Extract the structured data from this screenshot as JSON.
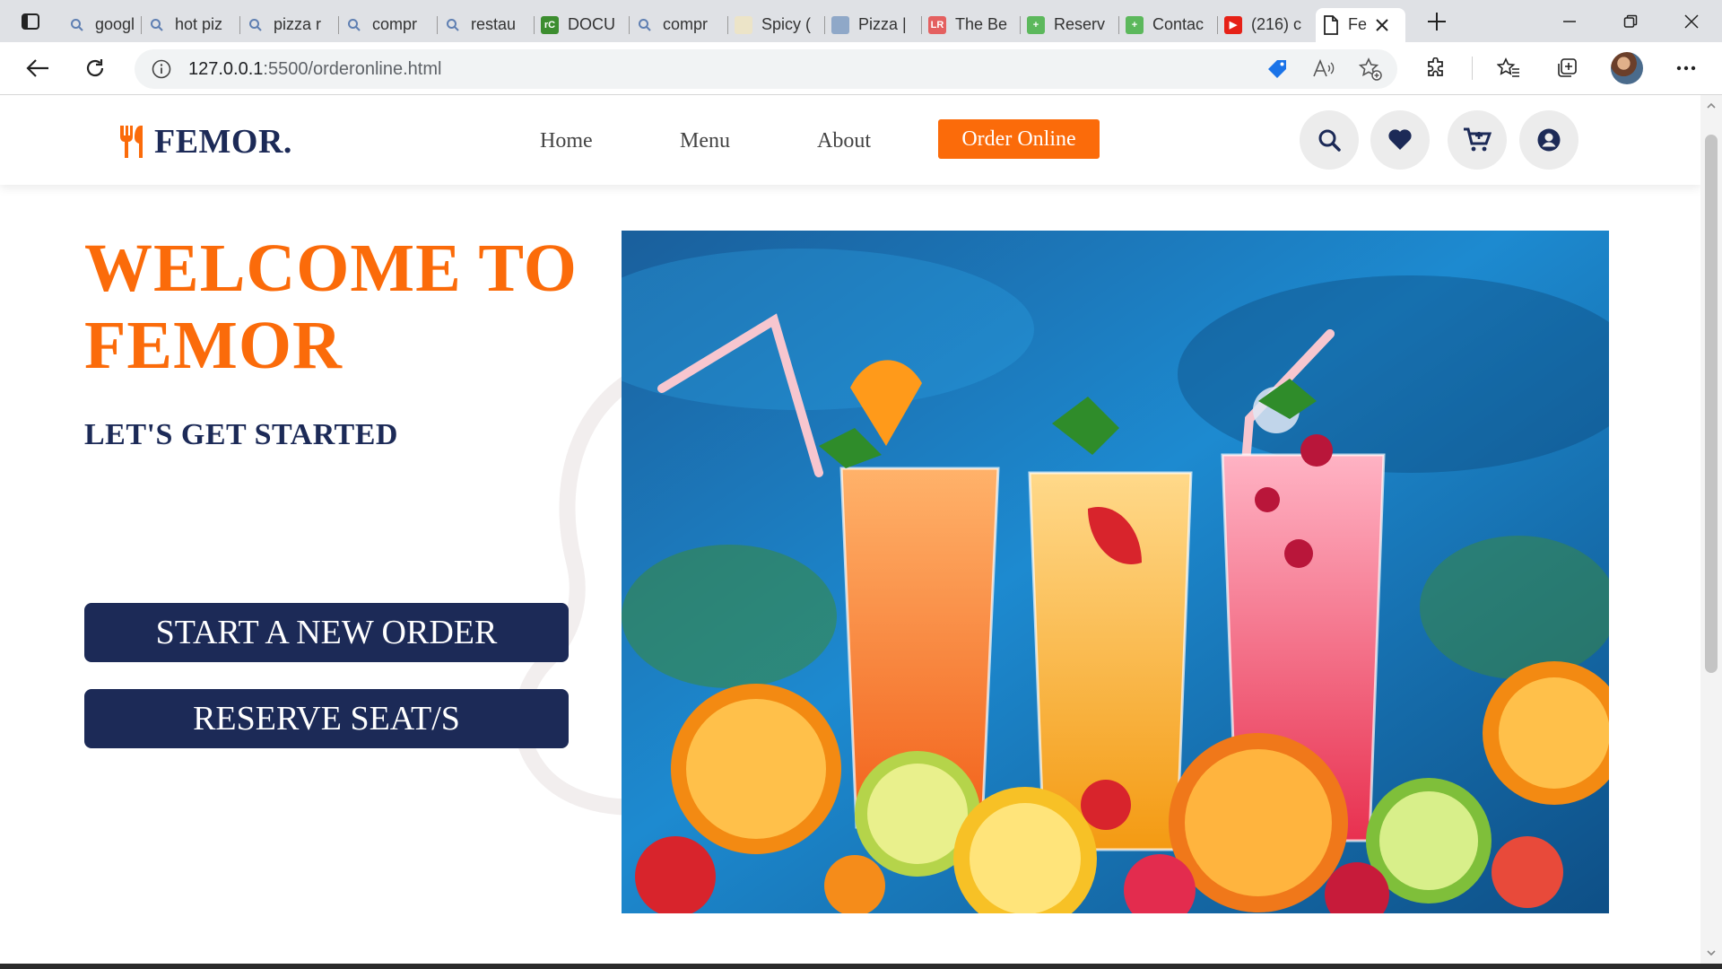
{
  "browser": {
    "tabs": [
      {
        "label": "google",
        "favicon": "search-icon"
      },
      {
        "label": "hot piz",
        "favicon": "search-icon"
      },
      {
        "label": "pizza r",
        "favicon": "search-icon"
      },
      {
        "label": "compr",
        "favicon": "search-icon"
      },
      {
        "label": "restau",
        "favicon": "search-icon"
      },
      {
        "label": "DOCU",
        "favicon": "rc-icon"
      },
      {
        "label": "compr",
        "favicon": "search-icon"
      },
      {
        "label": "Spicy (",
        "favicon": "page-icon"
      },
      {
        "label": "Pizza |",
        "favicon": "pizza-site-icon"
      },
      {
        "label": "The Be",
        "favicon": "lr-icon"
      },
      {
        "label": "Reserv",
        "favicon": "plus-icon"
      },
      {
        "label": "Contac",
        "favicon": "plus-icon"
      },
      {
        "label": "(216) c",
        "favicon": "youtube-icon"
      },
      {
        "label": "Fe",
        "favicon": "document-icon",
        "active": true
      }
    ],
    "url_host": "127.0.0.1",
    "url_rest": ":5500/orderonline.html"
  },
  "site": {
    "logo_text": "FEMOR.",
    "nav": {
      "home": "Home",
      "menu": "Menu",
      "about": "About",
      "order_online": "Order Online"
    },
    "hero": {
      "title": "WELCOME TO FEMOR",
      "subtitle": "LET'S GET STARTED",
      "button_new_order": "START A NEW ORDER",
      "button_reserve": "RESERVE SEAT/S"
    },
    "colors": {
      "accent": "#fb6b0a",
      "navy": "#1c2a57"
    }
  }
}
